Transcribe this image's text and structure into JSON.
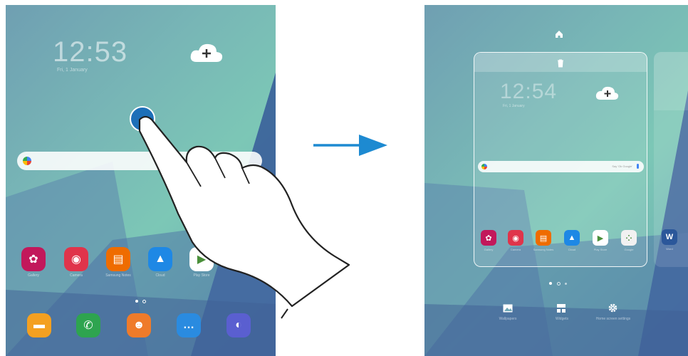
{
  "before": {
    "clock_time": "12:53",
    "clock_date": "Fri, 1 January",
    "apps_row": [
      {
        "name": "Gallery",
        "color": "#c2185b",
        "glyph": "✿"
      },
      {
        "name": "Camera",
        "color": "#e0344b",
        "glyph": "◉"
      },
      {
        "name": "Samsung Notes",
        "color": "#ef6c00",
        "glyph": "▤"
      },
      {
        "name": "Cloud",
        "color": "#1e88e5",
        "glyph": "▲"
      },
      {
        "name": "Play Store",
        "color": "#ffffff",
        "glyph": "▶"
      }
    ],
    "dock_apps": [
      {
        "name": "My Files",
        "color": "#f4a020",
        "glyph": "▬"
      },
      {
        "name": "Phone",
        "color": "#2ea44f",
        "glyph": "✆"
      },
      {
        "name": "Contacts",
        "color": "#ef7b2a",
        "glyph": "☻"
      },
      {
        "name": "Messages",
        "color": "#2a8be0",
        "glyph": "…"
      },
      {
        "name": "Internet",
        "color": "#5a5fd0",
        "glyph": "◐"
      }
    ]
  },
  "after": {
    "clock_time": "12:54",
    "clock_date": "Fri, 1 January",
    "search_hint": "Say 'Ok Google'",
    "apps_row": [
      {
        "name": "Gallery",
        "color": "#c2185b",
        "glyph": "✿"
      },
      {
        "name": "Camera",
        "color": "#e0344b",
        "glyph": "◉"
      },
      {
        "name": "Samsung Notes",
        "color": "#ef6c00",
        "glyph": "▤"
      },
      {
        "name": "Cloud",
        "color": "#1e88e5",
        "glyph": "▲"
      },
      {
        "name": "Play Store",
        "color": "#ffffff",
        "glyph": "▶"
      },
      {
        "name": "Google",
        "color": "#f1f1f1",
        "glyph": "⁘"
      }
    ],
    "next_panel_app": {
      "name": "Word",
      "color": "#2b579a",
      "glyph": "W"
    },
    "bottom_options": [
      {
        "label": "Wallpapers",
        "icon": "image-icon"
      },
      {
        "label": "Widgets",
        "icon": "widgets-icon"
      },
      {
        "label": "Home screen settings",
        "icon": "gear-icon"
      }
    ]
  },
  "colors": {
    "accent": "#1d8ad1",
    "touch": "#1d6fb8"
  }
}
